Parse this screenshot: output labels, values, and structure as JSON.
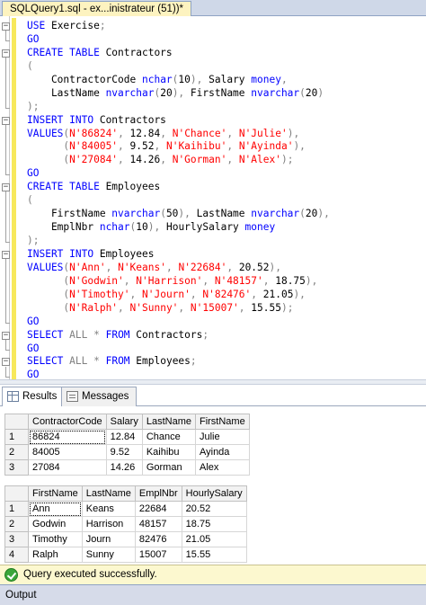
{
  "document_tab": {
    "title": "SQLQuery1.sql - ex...inistrateur (51))*"
  },
  "editor": {
    "lines": [
      [
        {
          "t": "USE ",
          "c": "kw"
        },
        {
          "t": "Exercise",
          "c": "plain"
        },
        {
          "t": ";",
          "c": "gray"
        }
      ],
      [
        {
          "t": "GO",
          "c": "kw"
        }
      ],
      [
        {
          "t": "CREATE TABLE ",
          "c": "kw"
        },
        {
          "t": "Contractors",
          "c": "plain"
        }
      ],
      [
        {
          "t": "(",
          "c": "gray"
        }
      ],
      [
        {
          "t": "    ContractorCode ",
          "c": "plain"
        },
        {
          "t": "nchar",
          "c": "kw"
        },
        {
          "t": "(",
          "c": "gray"
        },
        {
          "t": "10",
          "c": "plain"
        },
        {
          "t": "), ",
          "c": "gray"
        },
        {
          "t": "Salary ",
          "c": "plain"
        },
        {
          "t": "money",
          "c": "kw"
        },
        {
          "t": ",",
          "c": "gray"
        }
      ],
      [
        {
          "t": "    LastName ",
          "c": "plain"
        },
        {
          "t": "nvarchar",
          "c": "kw"
        },
        {
          "t": "(",
          "c": "gray"
        },
        {
          "t": "20",
          "c": "plain"
        },
        {
          "t": "), ",
          "c": "gray"
        },
        {
          "t": "FirstName ",
          "c": "plain"
        },
        {
          "t": "nvarchar",
          "c": "kw"
        },
        {
          "t": "(",
          "c": "gray"
        },
        {
          "t": "20",
          "c": "plain"
        },
        {
          "t": ")",
          "c": "gray"
        }
      ],
      [
        {
          "t": ");",
          "c": "gray"
        }
      ],
      [
        {
          "t": "INSERT INTO ",
          "c": "kw"
        },
        {
          "t": "Contractors",
          "c": "plain"
        }
      ],
      [
        {
          "t": "VALUES",
          "c": "kw"
        },
        {
          "t": "(",
          "c": "gray"
        },
        {
          "t": "N'86824'",
          "c": "str"
        },
        {
          "t": ", ",
          "c": "gray"
        },
        {
          "t": "12.84",
          "c": "plain"
        },
        {
          "t": ", ",
          "c": "gray"
        },
        {
          "t": "N'Chance'",
          "c": "str"
        },
        {
          "t": ", ",
          "c": "gray"
        },
        {
          "t": "N'Julie'",
          "c": "str"
        },
        {
          "t": "),",
          "c": "gray"
        }
      ],
      [
        {
          "t": "      (",
          "c": "gray"
        },
        {
          "t": "N'84005'",
          "c": "str"
        },
        {
          "t": ", ",
          "c": "gray"
        },
        {
          "t": "9.52",
          "c": "plain"
        },
        {
          "t": ", ",
          "c": "gray"
        },
        {
          "t": "N'Kaihibu'",
          "c": "str"
        },
        {
          "t": ", ",
          "c": "gray"
        },
        {
          "t": "N'Ayinda'",
          "c": "str"
        },
        {
          "t": "),",
          "c": "gray"
        }
      ],
      [
        {
          "t": "      (",
          "c": "gray"
        },
        {
          "t": "N'27084'",
          "c": "str"
        },
        {
          "t": ", ",
          "c": "gray"
        },
        {
          "t": "14.26",
          "c": "plain"
        },
        {
          "t": ", ",
          "c": "gray"
        },
        {
          "t": "N'Gorman'",
          "c": "str"
        },
        {
          "t": ", ",
          "c": "gray"
        },
        {
          "t": "N'Alex'",
          "c": "str"
        },
        {
          "t": ");",
          "c": "gray"
        }
      ],
      [
        {
          "t": "GO",
          "c": "kw"
        }
      ],
      [
        {
          "t": "CREATE TABLE ",
          "c": "kw"
        },
        {
          "t": "Employees",
          "c": "plain"
        }
      ],
      [
        {
          "t": "(",
          "c": "gray"
        }
      ],
      [
        {
          "t": "    FirstName ",
          "c": "plain"
        },
        {
          "t": "nvarchar",
          "c": "kw"
        },
        {
          "t": "(",
          "c": "gray"
        },
        {
          "t": "50",
          "c": "plain"
        },
        {
          "t": "), ",
          "c": "gray"
        },
        {
          "t": "LastName ",
          "c": "plain"
        },
        {
          "t": "nvarchar",
          "c": "kw"
        },
        {
          "t": "(",
          "c": "gray"
        },
        {
          "t": "20",
          "c": "plain"
        },
        {
          "t": "),",
          "c": "gray"
        }
      ],
      [
        {
          "t": "    EmplNbr ",
          "c": "plain"
        },
        {
          "t": "nchar",
          "c": "kw"
        },
        {
          "t": "(",
          "c": "gray"
        },
        {
          "t": "10",
          "c": "plain"
        },
        {
          "t": "), ",
          "c": "gray"
        },
        {
          "t": "HourlySalary ",
          "c": "plain"
        },
        {
          "t": "money",
          "c": "kw"
        }
      ],
      [
        {
          "t": ");",
          "c": "gray"
        }
      ],
      [
        {
          "t": "INSERT INTO ",
          "c": "kw"
        },
        {
          "t": "Employees",
          "c": "plain"
        }
      ],
      [
        {
          "t": "VALUES",
          "c": "kw"
        },
        {
          "t": "(",
          "c": "gray"
        },
        {
          "t": "N'Ann'",
          "c": "str"
        },
        {
          "t": ", ",
          "c": "gray"
        },
        {
          "t": "N'Keans'",
          "c": "str"
        },
        {
          "t": ", ",
          "c": "gray"
        },
        {
          "t": "N'22684'",
          "c": "str"
        },
        {
          "t": ", ",
          "c": "gray"
        },
        {
          "t": "20.52",
          "c": "plain"
        },
        {
          "t": "),",
          "c": "gray"
        }
      ],
      [
        {
          "t": "      (",
          "c": "gray"
        },
        {
          "t": "N'Godwin'",
          "c": "str"
        },
        {
          "t": ", ",
          "c": "gray"
        },
        {
          "t": "N'Harrison'",
          "c": "str"
        },
        {
          "t": ", ",
          "c": "gray"
        },
        {
          "t": "N'48157'",
          "c": "str"
        },
        {
          "t": ", ",
          "c": "gray"
        },
        {
          "t": "18.75",
          "c": "plain"
        },
        {
          "t": "),",
          "c": "gray"
        }
      ],
      [
        {
          "t": "      (",
          "c": "gray"
        },
        {
          "t": "N'Timothy'",
          "c": "str"
        },
        {
          "t": ", ",
          "c": "gray"
        },
        {
          "t": "N'Journ'",
          "c": "str"
        },
        {
          "t": ", ",
          "c": "gray"
        },
        {
          "t": "N'82476'",
          "c": "str"
        },
        {
          "t": ", ",
          "c": "gray"
        },
        {
          "t": "21.05",
          "c": "plain"
        },
        {
          "t": "),",
          "c": "gray"
        }
      ],
      [
        {
          "t": "      (",
          "c": "gray"
        },
        {
          "t": "N'Ralph'",
          "c": "str"
        },
        {
          "t": ", ",
          "c": "gray"
        },
        {
          "t": "N'Sunny'",
          "c": "str"
        },
        {
          "t": ", ",
          "c": "gray"
        },
        {
          "t": "N'15007'",
          "c": "str"
        },
        {
          "t": ", ",
          "c": "gray"
        },
        {
          "t": "15.55",
          "c": "plain"
        },
        {
          "t": ");",
          "c": "gray"
        }
      ],
      [
        {
          "t": "GO",
          "c": "kw"
        }
      ],
      [
        {
          "t": "SELECT ",
          "c": "kw"
        },
        {
          "t": "ALL",
          "c": "gray"
        },
        {
          "t": " * ",
          "c": "gray"
        },
        {
          "t": "FROM ",
          "c": "kw"
        },
        {
          "t": "Contractors",
          "c": "plain"
        },
        {
          "t": ";",
          "c": "gray"
        }
      ],
      [
        {
          "t": "GO",
          "c": "kw"
        }
      ],
      [
        {
          "t": "SELECT ",
          "c": "kw"
        },
        {
          "t": "ALL",
          "c": "gray"
        },
        {
          "t": " * ",
          "c": "gray"
        },
        {
          "t": "FROM ",
          "c": "kw"
        },
        {
          "t": "Employees",
          "c": "plain"
        },
        {
          "t": ";",
          "c": "gray"
        }
      ],
      [
        {
          "t": "GO",
          "c": "kw"
        }
      ]
    ]
  },
  "result_tabs": {
    "results_label": "Results",
    "messages_label": "Messages"
  },
  "contractors_grid": {
    "columns": [
      "ContractorCode",
      "Salary",
      "LastName",
      "FirstName"
    ],
    "rows": [
      [
        "1",
        "86824",
        "12.84",
        "Chance",
        "Julie"
      ],
      [
        "2",
        "84005",
        "9.52",
        "Kaihibu",
        "Ayinda"
      ],
      [
        "3",
        "27084",
        "14.26",
        "Gorman",
        "Alex"
      ]
    ]
  },
  "employees_grid": {
    "columns": [
      "FirstName",
      "LastName",
      "EmplNbr",
      "HourlySalary"
    ],
    "rows": [
      [
        "1",
        "Ann",
        "Keans",
        "22684",
        "20.52"
      ],
      [
        "2",
        "Godwin",
        "Harrison",
        "48157",
        "18.75"
      ],
      [
        "3",
        "Timothy",
        "Journ",
        "82476",
        "21.05"
      ],
      [
        "4",
        "Ralph",
        "Sunny",
        "15007",
        "15.55"
      ]
    ]
  },
  "status": {
    "message": "Query executed successfully."
  },
  "output_panel": {
    "label": "Output"
  },
  "colors": {
    "keyword": "#0000ff",
    "string": "#ff0000",
    "operator": "#808080",
    "status_bar": "#fcf8cf",
    "change_bar": "#f7e85b"
  }
}
